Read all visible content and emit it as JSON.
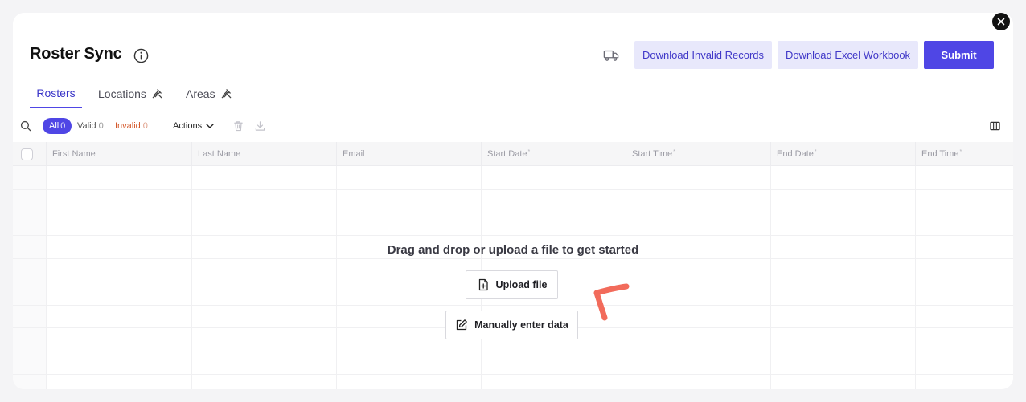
{
  "header": {
    "title": "Roster Sync",
    "download_invalid_label": "Download Invalid Records",
    "download_excel_label": "Download Excel Workbook",
    "submit_label": "Submit"
  },
  "tabs": [
    {
      "label": "Rosters",
      "active": true
    },
    {
      "label": "Locations",
      "active": false
    },
    {
      "label": "Areas",
      "active": false
    }
  ],
  "toolbar": {
    "filters": [
      {
        "label": "All",
        "count": "0"
      },
      {
        "label": "Valid",
        "count": "0"
      },
      {
        "label": "Invalid",
        "count": "0"
      }
    ],
    "actions_label": "Actions"
  },
  "grid": {
    "columns": [
      {
        "label": "First Name",
        "required": ""
      },
      {
        "label": "Last Name",
        "required": ""
      },
      {
        "label": "Email",
        "required": ""
      },
      {
        "label": "Start Date",
        "required": "*"
      },
      {
        "label": "Start Time",
        "required": "*"
      },
      {
        "label": "End Date",
        "required": "*"
      },
      {
        "label": "End Time",
        "required": "*"
      }
    ]
  },
  "empty_state": {
    "message": "Drag and drop or upload a file to get started",
    "upload_label": "Upload file",
    "manual_label": "Manually enter data"
  },
  "colors": {
    "accent": "#4f46e5",
    "accent_light": "#e8e8fb",
    "invalid": "#d4592b",
    "annotation": "#f26b5b"
  }
}
